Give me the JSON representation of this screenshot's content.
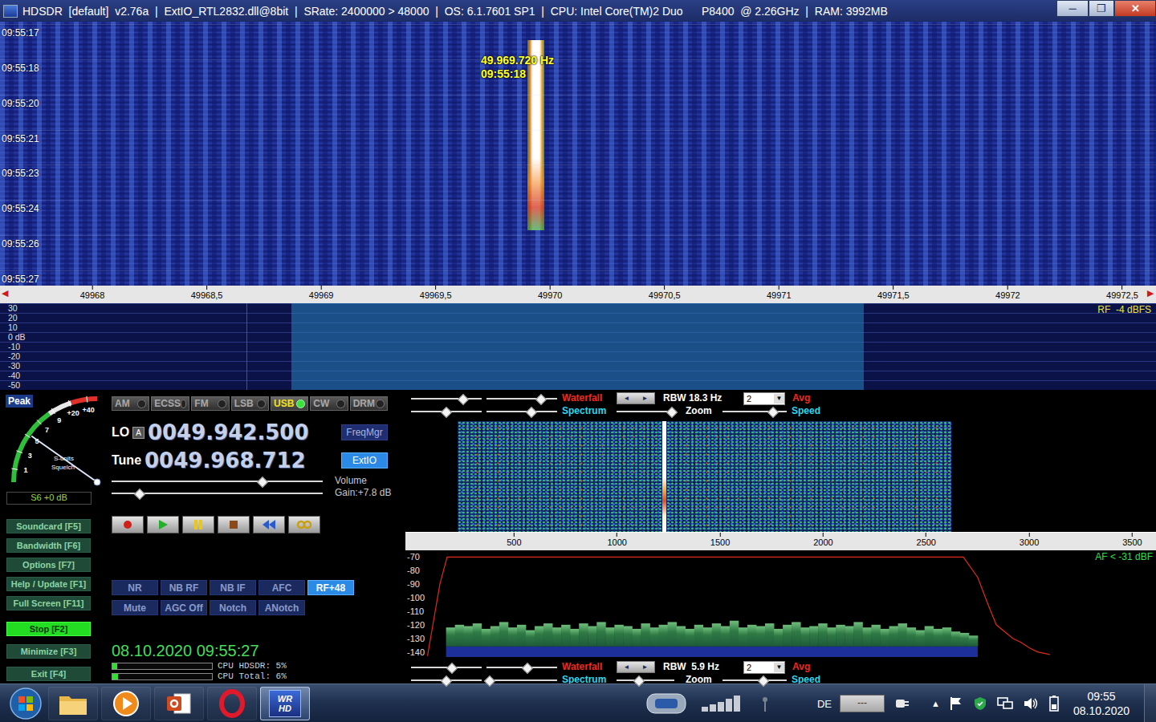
{
  "window": {
    "title": "HDSDR  [default]  v2.76a  |  ExtIO_RTL2832.dll@8bit  |  SRate: 2400000 > 48000  |  OS: 6.1.7601 SP1  |  CPU: Intel Core(TM)2 Duo      P8400  @ 2.26GHz  |  RAM: 3992MB",
    "controls": [
      {
        "glyph": "─",
        "kind": "minimize"
      },
      {
        "glyph": "❐",
        "kind": "restore"
      },
      {
        "glyph": "✕",
        "kind": "close"
      }
    ]
  },
  "waterfall": {
    "times": [
      "09:55:17",
      "09:55:18",
      "09:55:20",
      "09:55:21",
      "09:55:23",
      "09:55:24",
      "09:55:26",
      "09:55:27"
    ],
    "tooltip": {
      "freq": "49.969.720 Hz",
      "time": "09:55:18"
    }
  },
  "freq_axis": {
    "ticks": [
      "49968",
      "49968,5",
      "49969",
      "49969,5",
      "49970",
      "49970,5",
      "49971",
      "49971,5",
      "49972",
      "49972,5"
    ],
    "edge_marks": [
      "◀",
      "▶"
    ]
  },
  "rf_spectrum": {
    "scale": [
      "30",
      "20",
      "10",
      "0 dB",
      "-10",
      "-20",
      "-30",
      "-40",
      "-50"
    ],
    "reading": "RF  -4 dBFS"
  },
  "s_meter": {
    "peak": "Peak",
    "scale": [
      "1",
      "3",
      "5",
      "7",
      "9",
      "+20",
      "+40"
    ],
    "units": "S-units",
    "squelch": "Squelch",
    "level": 0.39,
    "reading": "S6 +0 dB"
  },
  "modes": [
    {
      "label": "AM",
      "selected": false
    },
    {
      "label": "ECSS",
      "selected": false
    },
    {
      "label": "FM",
      "selected": false
    },
    {
      "label": "LSB",
      "selected": false
    },
    {
      "label": "USB",
      "selected": true
    },
    {
      "label": "CW",
      "selected": false
    },
    {
      "label": "DRM",
      "selected": false
    }
  ],
  "lo": {
    "label": "LO",
    "bank": "A",
    "value": "0049.942.500"
  },
  "tune": {
    "label": "Tune",
    "value": "0049.968.712"
  },
  "freqmgr": {
    "label": "FreqMgr",
    "selected": false
  },
  "extio": {
    "label": "ExtIO",
    "selected": true
  },
  "volume": {
    "label": "Volume",
    "level": 0.71,
    "gain": "Gain:+7.8 dB",
    "gain_level": 0.13
  },
  "transport": [
    {
      "kind": "record"
    },
    {
      "kind": "play"
    },
    {
      "kind": "pause"
    },
    {
      "kind": "stop"
    },
    {
      "kind": "rewind"
    },
    {
      "kind": "loop"
    }
  ],
  "function_buttons": [
    [
      {
        "label": "Soundcard [F5]",
        "selected": false
      },
      {
        "label": "Bandwidth [F6]",
        "selected": false
      },
      {
        "label": "Options [F7]",
        "selected": false
      },
      {
        "label": "Help / Update [F1]",
        "selected": false
      },
      {
        "label": "Full Screen [F11]",
        "selected": false
      }
    ],
    [
      {
        "label": "Stop [F2]",
        "selected": true
      },
      {
        "label": "Minimize [F3]",
        "selected": false
      },
      {
        "label": "Exit [F4]",
        "selected": false
      }
    ]
  ],
  "dsp_buttons": [
    {
      "label": "NR",
      "on": false
    },
    {
      "label": "NB RF",
      "on": false
    },
    {
      "label": "NB IF",
      "on": false
    },
    {
      "label": "AFC",
      "on": false
    },
    {
      "label": "RF+48",
      "on": true
    },
    {
      "label": "Mute",
      "on": false
    },
    {
      "label": "AGC Off",
      "on": false
    },
    {
      "label": "Notch",
      "on": false
    },
    {
      "label": "ANotch",
      "on": false
    }
  ],
  "clock": "08.10.2020 09:55:27",
  "cpu": [
    {
      "label": "CPU HDSDR: 5%",
      "level": 0.05
    },
    {
      "label": "CPU Total: 6%",
      "level": 0.06
    }
  ],
  "af_controls_top": {
    "waterfall": "Waterfall",
    "arrows": [
      "◄",
      "►"
    ],
    "rbw": "RBW 18.3 Hz",
    "avg_value": "2",
    "dropdown_arrow": "▼",
    "avg": "Avg",
    "spectrum": "Spectrum",
    "zoom": "Zoom",
    "speed": "Speed",
    "row1_sliders": [
      0.73,
      0.76
    ],
    "row2_sliders": [
      0.49,
      0.63
    ],
    "zoom_level": 0.95,
    "speed_level": 0.77
  },
  "af_controls_bottom": {
    "waterfall": "Waterfall",
    "arrows": [
      "◄",
      "►"
    ],
    "rbw": "RBW  5.9 Hz",
    "avg_value": "2",
    "dropdown_arrow": "▼",
    "avg": "Avg",
    "spectrum": "Spectrum",
    "zoom": "Zoom",
    "speed": "Speed",
    "row1_sliders": [
      0.57,
      0.57
    ],
    "row2_sliders": [
      0.49,
      0.03
    ],
    "zoom_level": 0.38,
    "speed_level": 0.62
  },
  "af_axis": {
    "ticks": [
      "500",
      "1000",
      "1500",
      "2000",
      "2500",
      "3000",
      "3500"
    ]
  },
  "af_spectrum": {
    "scale": [
      "-70",
      "-80",
      "-90",
      "-100",
      "-110",
      "-120",
      "-130",
      "-140"
    ],
    "reading": "AF < -31 dBF",
    "noise_from_hz": 170,
    "noise_step_hz": 43,
    "noise": [
      -122,
      -120,
      -121,
      -119,
      -123,
      -121,
      -118,
      -122,
      -120,
      -124,
      -121,
      -119,
      -122,
      -120,
      -123,
      -119,
      -121,
      -118,
      -122,
      -120,
      -121,
      -123,
      -119,
      -122,
      -120,
      -118,
      -121,
      -123,
      -120,
      -122,
      -119,
      -121,
      -117,
      -122,
      -120,
      -121,
      -119,
      -123,
      -120,
      -118,
      -122,
      -121,
      -119,
      -122,
      -120,
      -121,
      -118,
      -122,
      -120,
      -123,
      -121,
      -119,
      -122,
      -124,
      -121,
      -123,
      -122,
      -125,
      -126,
      -128
    ],
    "filter_hz": [
      80,
      140,
      175,
      2680,
      2750,
      2800,
      2840,
      2880,
      2920,
      2960,
      3000,
      3040,
      3100
    ],
    "filter_db": [
      -143,
      -90,
      -70,
      -70,
      -85,
      -105,
      -120,
      -125,
      -130,
      -133,
      -137,
      -140,
      -142
    ]
  },
  "taskbar": {
    "apps": [
      {
        "kind": "explorer",
        "active": false
      },
      {
        "kind": "media",
        "active": false
      },
      {
        "kind": "powerpoint",
        "active": false
      },
      {
        "kind": "opera",
        "active": false
      },
      {
        "kind": "hdsdr",
        "active": true,
        "labels": [
          "WR",
          "HD"
        ]
      }
    ],
    "tray_left": [
      {
        "kind": "device"
      },
      {
        "kind": "signal"
      },
      {
        "kind": "antenna"
      }
    ],
    "language": "DE",
    "tray_box": "---",
    "tray_arrow": "▲",
    "tray_icons": [
      {
        "kind": "flag"
      },
      {
        "kind": "shield"
      },
      {
        "kind": "network"
      },
      {
        "kind": "speaker"
      },
      {
        "kind": "battery"
      }
    ],
    "time": "09:55",
    "date": "08.10.2020"
  }
}
